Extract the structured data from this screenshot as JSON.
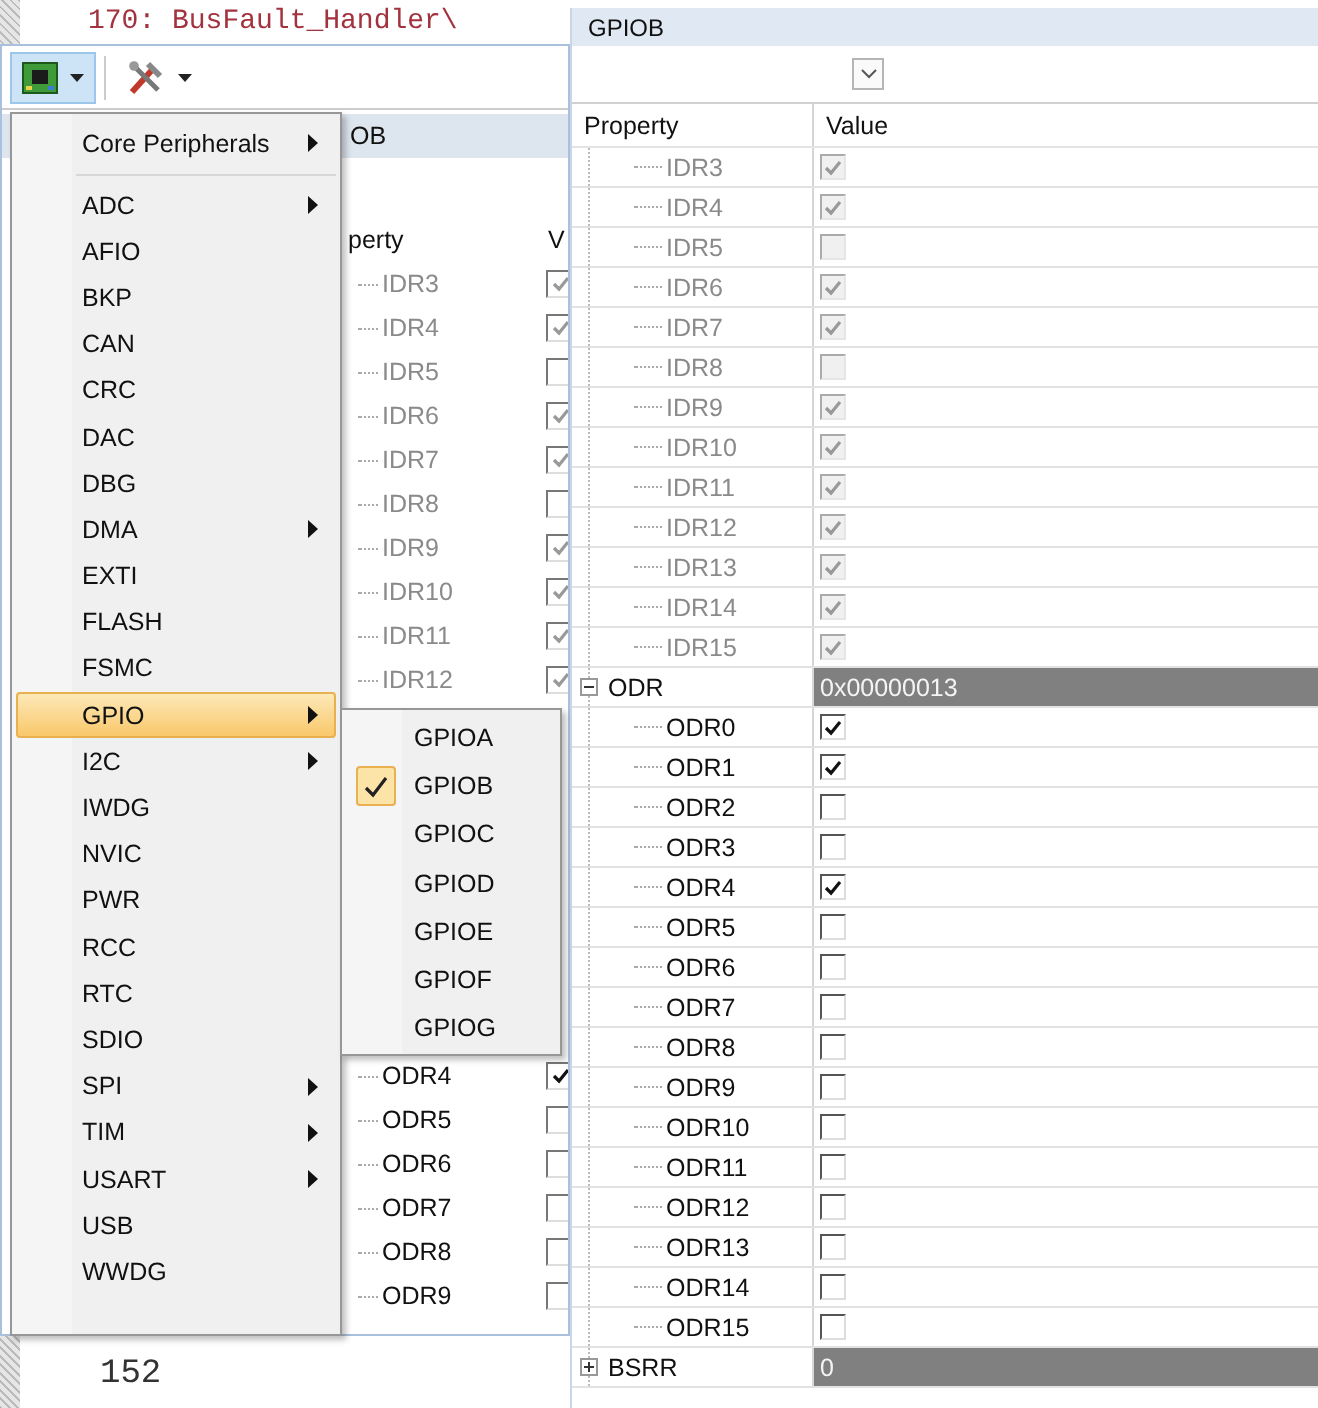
{
  "editor": {
    "code_line": "170: BusFault_Handler\\",
    "line_number": "152"
  },
  "back_window": {
    "title": "OB",
    "columns": [
      "perty",
      "V"
    ],
    "rows_top": [
      {
        "name": "IDR3",
        "checked": true
      },
      {
        "name": "IDR4",
        "checked": true
      },
      {
        "name": "IDR5",
        "checked": false
      },
      {
        "name": "IDR6",
        "checked": true
      },
      {
        "name": "IDR7",
        "checked": true
      },
      {
        "name": "IDR8",
        "checked": false
      },
      {
        "name": "IDR9",
        "checked": true
      },
      {
        "name": "IDR10",
        "checked": true
      },
      {
        "name": "IDR11",
        "checked": true
      },
      {
        "name": "IDR12",
        "checked": true
      }
    ],
    "rows_bottom": [
      {
        "name": "ODR4",
        "checked": true
      },
      {
        "name": "ODR5",
        "checked": false
      },
      {
        "name": "ODR6",
        "checked": false
      },
      {
        "name": "ODR7",
        "checked": false
      },
      {
        "name": "ODR8",
        "checked": false
      },
      {
        "name": "ODR9",
        "checked": false
      }
    ]
  },
  "menu": {
    "items": [
      {
        "kind": "item",
        "label": "Core Peripherals",
        "submenu": true,
        "highlighted": false
      },
      {
        "kind": "separator"
      },
      {
        "kind": "item",
        "label": "ADC",
        "submenu": true,
        "highlighted": false
      },
      {
        "kind": "item",
        "label": "AFIO",
        "submenu": false,
        "highlighted": false
      },
      {
        "kind": "item",
        "label": "BKP",
        "submenu": false,
        "highlighted": false
      },
      {
        "kind": "item",
        "label": "CAN",
        "submenu": false,
        "highlighted": false
      },
      {
        "kind": "item",
        "label": "CRC",
        "submenu": false,
        "highlighted": false
      },
      {
        "kind": "item",
        "label": "DAC",
        "submenu": false,
        "highlighted": false
      },
      {
        "kind": "item",
        "label": "DBG",
        "submenu": false,
        "highlighted": false
      },
      {
        "kind": "item",
        "label": "DMA",
        "submenu": true,
        "highlighted": false
      },
      {
        "kind": "item",
        "label": "EXTI",
        "submenu": false,
        "highlighted": false
      },
      {
        "kind": "item",
        "label": "FLASH",
        "submenu": false,
        "highlighted": false
      },
      {
        "kind": "item",
        "label": "FSMC",
        "submenu": false,
        "highlighted": false
      },
      {
        "kind": "item",
        "label": "GPIO",
        "submenu": true,
        "highlighted": true
      },
      {
        "kind": "item",
        "label": "I2C",
        "submenu": true,
        "highlighted": false
      },
      {
        "kind": "item",
        "label": "IWDG",
        "submenu": false,
        "highlighted": false
      },
      {
        "kind": "item",
        "label": "NVIC",
        "submenu": false,
        "highlighted": false
      },
      {
        "kind": "item",
        "label": "PWR",
        "submenu": false,
        "highlighted": false
      },
      {
        "kind": "item",
        "label": "RCC",
        "submenu": false,
        "highlighted": false
      },
      {
        "kind": "item",
        "label": "RTC",
        "submenu": false,
        "highlighted": false
      },
      {
        "kind": "item",
        "label": "SDIO",
        "submenu": false,
        "highlighted": false
      },
      {
        "kind": "item",
        "label": "SPI",
        "submenu": true,
        "highlighted": false
      },
      {
        "kind": "item",
        "label": "TIM",
        "submenu": true,
        "highlighted": false
      },
      {
        "kind": "item",
        "label": "USART",
        "submenu": true,
        "highlighted": false
      },
      {
        "kind": "item",
        "label": "USB",
        "submenu": false,
        "highlighted": false
      },
      {
        "kind": "item",
        "label": "WWDG",
        "submenu": false,
        "highlighted": false
      }
    ]
  },
  "submenu": {
    "items": [
      {
        "label": "GPIOA",
        "selected": false
      },
      {
        "label": "GPIOB",
        "selected": true
      },
      {
        "label": "GPIOC",
        "selected": false
      },
      {
        "label": "GPIOD",
        "selected": false
      },
      {
        "label": "GPIOE",
        "selected": false
      },
      {
        "label": "GPIOF",
        "selected": false
      },
      {
        "label": "GPIOG",
        "selected": false
      }
    ]
  },
  "window": {
    "title": "GPIOB",
    "columns": [
      "Property",
      "Value"
    ],
    "rows": [
      {
        "kind": "group",
        "children": [
          {
            "kind": "bit",
            "name": "IDR3",
            "checked": true,
            "disabled": true
          },
          {
            "kind": "bit",
            "name": "IDR4",
            "checked": true,
            "disabled": true
          },
          {
            "kind": "bit",
            "name": "IDR5",
            "checked": false,
            "disabled": true
          },
          {
            "kind": "bit",
            "name": "IDR6",
            "checked": true,
            "disabled": true
          },
          {
            "kind": "bit",
            "name": "IDR7",
            "checked": true,
            "disabled": true
          },
          {
            "kind": "bit",
            "name": "IDR8",
            "checked": false,
            "disabled": true
          },
          {
            "kind": "bit",
            "name": "IDR9",
            "checked": true,
            "disabled": true
          },
          {
            "kind": "bit",
            "name": "IDR10",
            "checked": true,
            "disabled": true
          },
          {
            "kind": "bit",
            "name": "IDR11",
            "checked": true,
            "disabled": true
          },
          {
            "kind": "bit",
            "name": "IDR12",
            "checked": true,
            "disabled": true
          },
          {
            "kind": "bit",
            "name": "IDR13",
            "checked": true,
            "disabled": true
          },
          {
            "kind": "bit",
            "name": "IDR14",
            "checked": true,
            "disabled": true
          },
          {
            "kind": "bit",
            "name": "IDR15",
            "checked": true,
            "disabled": true
          }
        ]
      },
      {
        "kind": "register",
        "name": "ODR",
        "value": "0x00000013",
        "expanded": true,
        "children": [
          {
            "kind": "bit",
            "name": "ODR0",
            "checked": true,
            "disabled": false
          },
          {
            "kind": "bit",
            "name": "ODR1",
            "checked": true,
            "disabled": false
          },
          {
            "kind": "bit",
            "name": "ODR2",
            "checked": false,
            "disabled": false
          },
          {
            "kind": "bit",
            "name": "ODR3",
            "checked": false,
            "disabled": false
          },
          {
            "kind": "bit",
            "name": "ODR4",
            "checked": true,
            "disabled": false
          },
          {
            "kind": "bit",
            "name": "ODR5",
            "checked": false,
            "disabled": false
          },
          {
            "kind": "bit",
            "name": "ODR6",
            "checked": false,
            "disabled": false
          },
          {
            "kind": "bit",
            "name": "ODR7",
            "checked": false,
            "disabled": false
          },
          {
            "kind": "bit",
            "name": "ODR8",
            "checked": false,
            "disabled": false
          },
          {
            "kind": "bit",
            "name": "ODR9",
            "checked": false,
            "disabled": false
          },
          {
            "kind": "bit",
            "name": "ODR10",
            "checked": false,
            "disabled": false
          },
          {
            "kind": "bit",
            "name": "ODR11",
            "checked": false,
            "disabled": false
          },
          {
            "kind": "bit",
            "name": "ODR12",
            "checked": false,
            "disabled": false
          },
          {
            "kind": "bit",
            "name": "ODR13",
            "checked": false,
            "disabled": false
          },
          {
            "kind": "bit",
            "name": "ODR14",
            "checked": false,
            "disabled": false
          },
          {
            "kind": "bit",
            "name": "ODR15",
            "checked": false,
            "disabled": false
          }
        ]
      },
      {
        "kind": "register",
        "name": "BSRR",
        "value": "0",
        "expanded": false,
        "children": []
      }
    ]
  }
}
